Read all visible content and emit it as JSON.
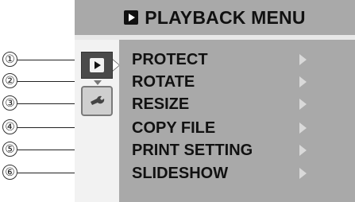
{
  "header": {
    "title": "PLAYBACK MENU"
  },
  "menu": {
    "items": [
      {
        "num": "1",
        "label": "PROTECT"
      },
      {
        "num": "2",
        "label": "ROTATE"
      },
      {
        "num": "3",
        "label": "RESIZE"
      },
      {
        "num": "4",
        "label": "COPY FILE"
      },
      {
        "num": "5",
        "label": "PRINT SETTING"
      },
      {
        "num": "6",
        "label": "SLIDESHOW"
      }
    ]
  },
  "colors": {
    "header_bg": "#a9a9a9",
    "menu_bg": "#a9a9a9",
    "left_col_bg": "#f2f2f2",
    "active_tab": "#4a4a4a",
    "arrow": "#d9d9d9"
  },
  "icons": {
    "title": "playback-icon",
    "tab_active": "playback-tab-icon",
    "tab_setup": "wrench-icon",
    "item_arrow": "chevron-right-icon"
  }
}
